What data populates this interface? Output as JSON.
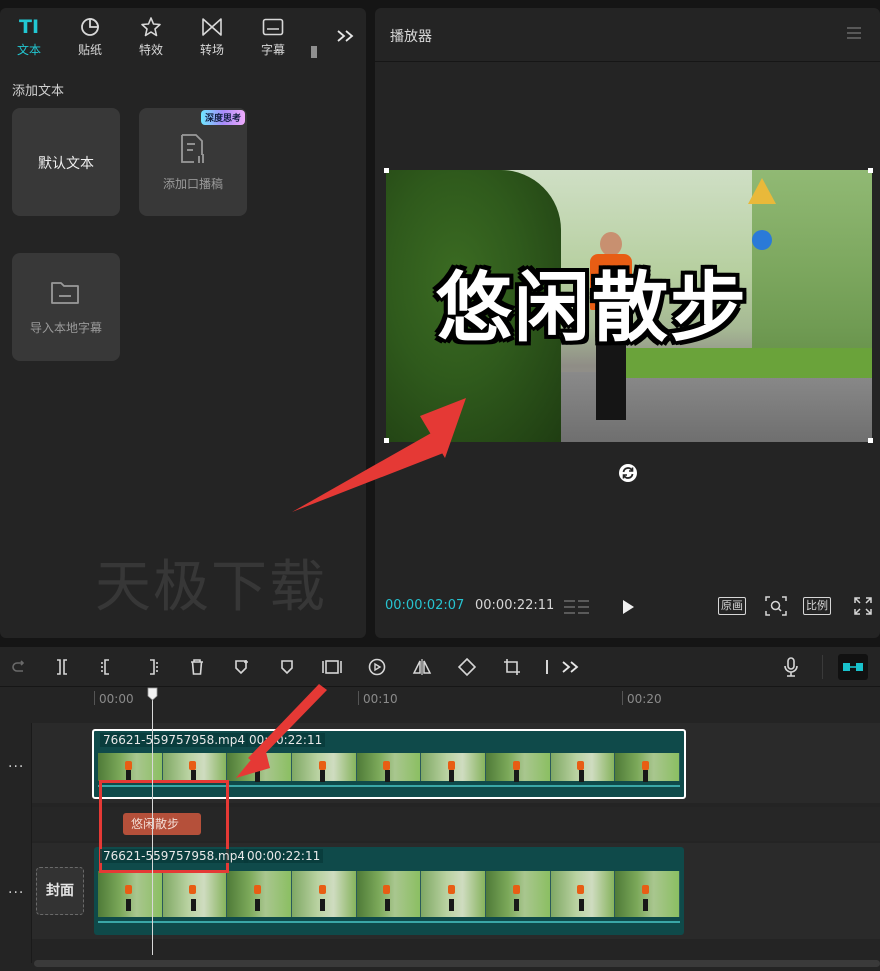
{
  "tabs": [
    {
      "icon": "TI",
      "label": "文本",
      "active": true
    },
    {
      "icon": "sticker-icon",
      "label": "贴纸"
    },
    {
      "icon": "effects-icon",
      "label": "特效"
    },
    {
      "icon": "transition-icon",
      "label": "转场"
    },
    {
      "icon": "subtitle-icon",
      "label": "字幕"
    }
  ],
  "left_panel": {
    "section_title": "添加文本",
    "cards": {
      "default_text": "默认文本",
      "speech_script": "添加口播稿",
      "speech_badge": "深度思考",
      "import_local": "导入本地字幕"
    },
    "watermark": "天极下载"
  },
  "player": {
    "title": "播放器",
    "caption": "悠闲散步",
    "current_time": "00:00:02:07",
    "total_time": "00:00:22:11",
    "btn_original": "原画",
    "btn_ratio": "比例"
  },
  "timeline": {
    "ruler_labels": [
      "00:00",
      "00:10",
      "00:20"
    ],
    "clip_main_name": "76621-559757958.mp4",
    "clip_main_duration": "00:00:22:11",
    "text_clip_label": "悠闲散步",
    "clip_second_name": "76621-559757958.mp4",
    "clip_second_duration": "00:00:22:11",
    "cover_label": "封面",
    "track_menu": "..."
  },
  "colors": {
    "accent": "#22c7d2",
    "highlight": "#e53935",
    "text_clip": "#b5503a",
    "video_clip": "#0f4a4a"
  }
}
